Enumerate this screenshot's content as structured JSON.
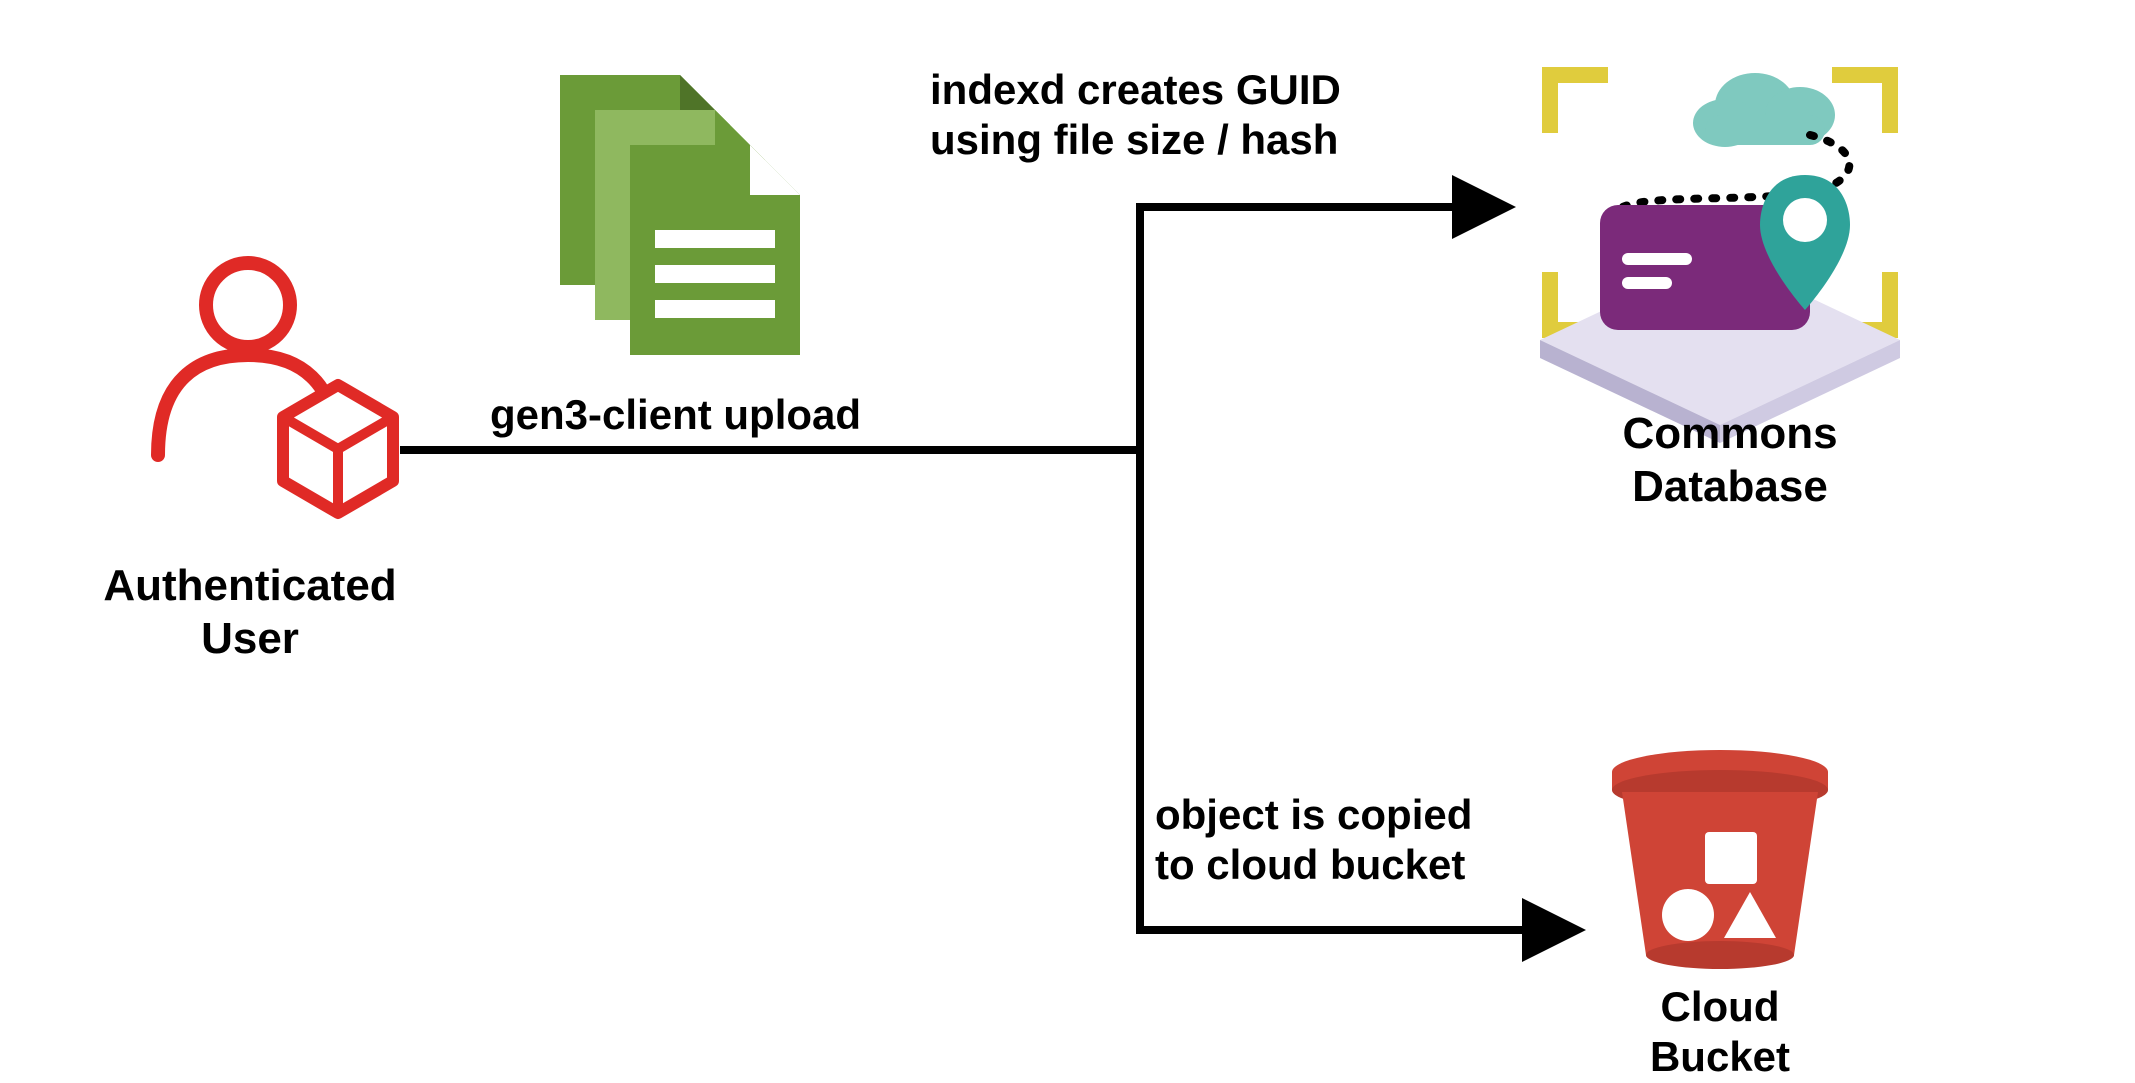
{
  "nodes": {
    "authenticated_user": {
      "label": "Authenticated\nUser"
    },
    "commons_database": {
      "label": "Commons\nDatabase"
    },
    "cloud_bucket": {
      "label": "Cloud\nBucket"
    }
  },
  "edges": {
    "upload": {
      "label": "gen3-client upload"
    },
    "to_database": {
      "label": "indexd creates GUID\nusing file size / hash"
    },
    "to_bucket": {
      "label": "object is copied\nto cloud bucket"
    }
  },
  "colors": {
    "user_red": "#E02A26",
    "doc_green": "#6B9B38",
    "doc_green_light": "#8FB85F",
    "db_purple": "#7B2A7A",
    "db_teal": "#2FA39A",
    "db_yellow": "#E0CC3D",
    "db_platform": "#E4E0F0",
    "bucket_red": "#CF4436",
    "bucket_red_dark": "#B73A2E",
    "black": "#000000"
  }
}
